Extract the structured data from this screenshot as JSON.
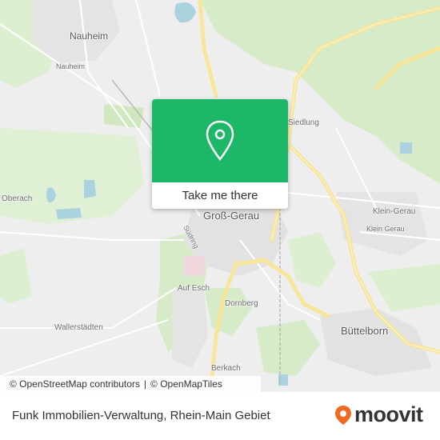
{
  "map": {
    "places": {
      "nauheim": "Nauheim",
      "nauheim_small": "Nauheim",
      "siedlung": "Siedlung",
      "oberach": "Oberach",
      "gross_gerau": "Groß-Gerau",
      "klein_gerau": "Klein-Gerau",
      "klein_gerau_small": "Klein Gerau",
      "suedring": "Südring",
      "auf_esch": "Auf Esch",
      "dornberg": "Dornberg",
      "wallerstaedten": "Wallerstädten",
      "buettelborn": "Büttelborn",
      "berkach": "Berkach"
    },
    "attribution": {
      "osm": "© OpenStreetMap contributors",
      "separator": "|",
      "omt": "© OpenMapTiles"
    }
  },
  "popup": {
    "icon": "location-pin-icon",
    "cta_label": "Take me there",
    "color": "#1db768"
  },
  "footer": {
    "title": "Funk Immobilien-Verwaltung, Rhein-Main Gebiet",
    "brand": "moovit",
    "brand_color": "#f26a21"
  }
}
